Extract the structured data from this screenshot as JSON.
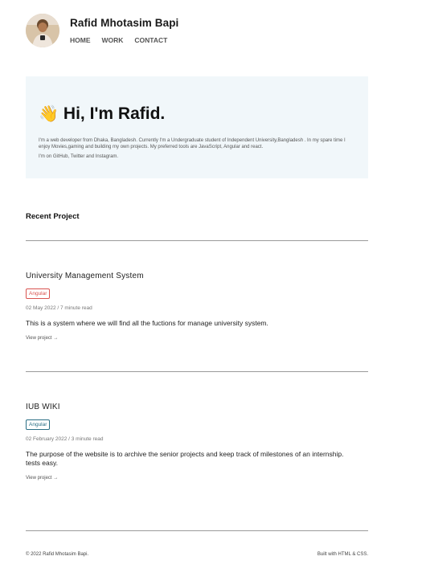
{
  "header": {
    "site_title": "Rafid Mhotasim Bapi",
    "nav": [
      "HOME",
      "WORK",
      "CONTACT"
    ]
  },
  "hero": {
    "greeting": "Hi, I'm Rafid.",
    "wave_icon": "👋",
    "bio": "I'm a web developer from Dhaka, Bangladesh. Currently I'm a Undergraduate student of Independent University,Bangladesh . In my spare time I enjoy Movies,gaming and building my own projects. My preferred tools are JavaScript, Angular and react.",
    "social": "I'm on GitHub, Twitter and Instagram."
  },
  "recent": {
    "title": "Recent Project"
  },
  "projects": [
    {
      "title": "University Management System",
      "tag": "Angular",
      "meta": "02 May 2022 / 7 minute read",
      "description": "This is a system where we will find all the fuctions for manage university system.",
      "link": "View project →"
    },
    {
      "title": "IUB WIKI",
      "tag": "Angular",
      "meta": "02 February 2022 / 3 minute read",
      "description": "The purpose of the website is to archive the senior projects and keep track of milestones of an internship. tests easy.",
      "link": "View project →"
    }
  ],
  "footer": {
    "copyright": "© 2022 Rafid Mhotasim Bapi.",
    "built_with": "Built with HTML & CSS."
  },
  "colors": {
    "hero_bg": "#f1f7fa",
    "tag_red": "#d9534f",
    "tag_teal": "#2a6f85"
  }
}
